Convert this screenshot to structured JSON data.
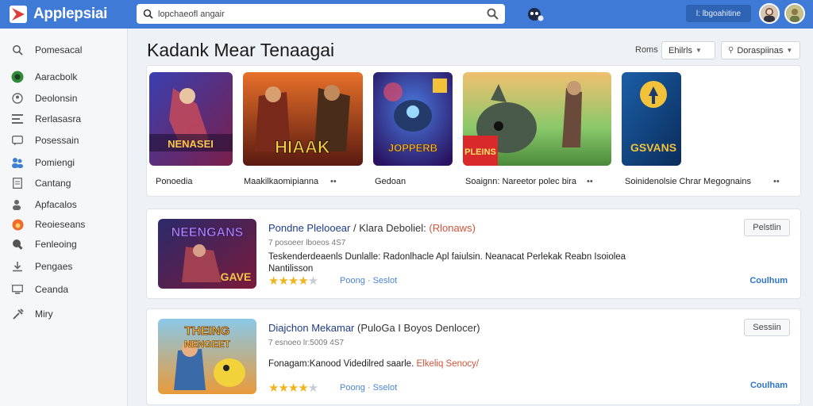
{
  "app": {
    "name": "Applepsiai",
    "search_value": "lopchaeofl angair",
    "user_label": "l: lbgoahitine"
  },
  "sidebar": {
    "items": [
      {
        "label": "Pomesacal",
        "icon": "search-icon"
      },
      {
        "label": "Aaracbolk",
        "icon": "gamepad-icon"
      },
      {
        "label": "Deolonsin",
        "icon": "user-icon"
      },
      {
        "label": "Rerlasasra",
        "icon": "list-icon"
      },
      {
        "label": "Posessain",
        "icon": "chat-icon"
      },
      {
        "label": "Pomiengi",
        "icon": "people-icon"
      },
      {
        "label": "Cantang",
        "icon": "document-icon"
      },
      {
        "label": "Apfacalos",
        "icon": "user-add-icon"
      },
      {
        "label": "Reoieseans",
        "icon": "fire-icon"
      },
      {
        "label": "Fenleoing",
        "icon": "bulb-icon"
      },
      {
        "label": "Pengaes",
        "icon": "download-icon"
      },
      {
        "label": "Ceanda",
        "icon": "monitor-icon"
      },
      {
        "label": "Miry",
        "icon": "tools-icon"
      }
    ]
  },
  "main": {
    "title": "Kadank Mear Tenaagai",
    "sort_label": "Roms",
    "dropdown1": "Ehilrls",
    "dropdown2": "Doraspiinas",
    "featured": [
      {
        "caption": "Ponoedia",
        "art_text": "NENASEI"
      },
      {
        "caption": "Maakilkaomipianna",
        "art_text": "HIAAK"
      },
      {
        "caption": "Gedoan",
        "art_text": "JOPPERB"
      },
      {
        "caption": "Soaignn: Nareetor polec bira",
        "art_text": "PLEINS"
      },
      {
        "caption": "Soinidenolsie Chrar Megognains",
        "art_text": "GSVANS"
      }
    ],
    "cards": [
      {
        "title_a": "Pondne Plelooear",
        "title_b": "/ Klara Deboliel:",
        "title_c": "(Rlonaws)",
        "meta": "7 posoeer lboeos 4S7",
        "desc": "Teskenderdeaenls Dunlalle: Radonlhacle Apl faiulsin. Neanacat Perlekak Reabn Isoiolea Nantilisson",
        "desc_hl": "",
        "rating": 4,
        "tags": "Poong · Seslot",
        "button": "Pelstlin",
        "link": "Coulhum",
        "art_text": "NEENGANS",
        "art_sub": "GAVE"
      },
      {
        "title_a": "Diajchon Mekamar",
        "title_b": "(PuloGa I Boyos Denlocer)",
        "title_c": "",
        "meta": "7 esnoeo lr:5009 4S7",
        "desc": "Fonagam:Kanood Videdilred saarle.",
        "desc_hl": "Elkeliq Senocy/",
        "rating": 4,
        "tags": "Poong · Sselot",
        "button": "Sessiin",
        "link": "Coulham",
        "art_text": "THEING",
        "art_sub": "NENGEET"
      }
    ]
  },
  "colors": {
    "topbar": "#3f7ad6",
    "accent_red": "#d4533a",
    "link_blue": "#2f74c9",
    "star": "#f0b41c"
  }
}
